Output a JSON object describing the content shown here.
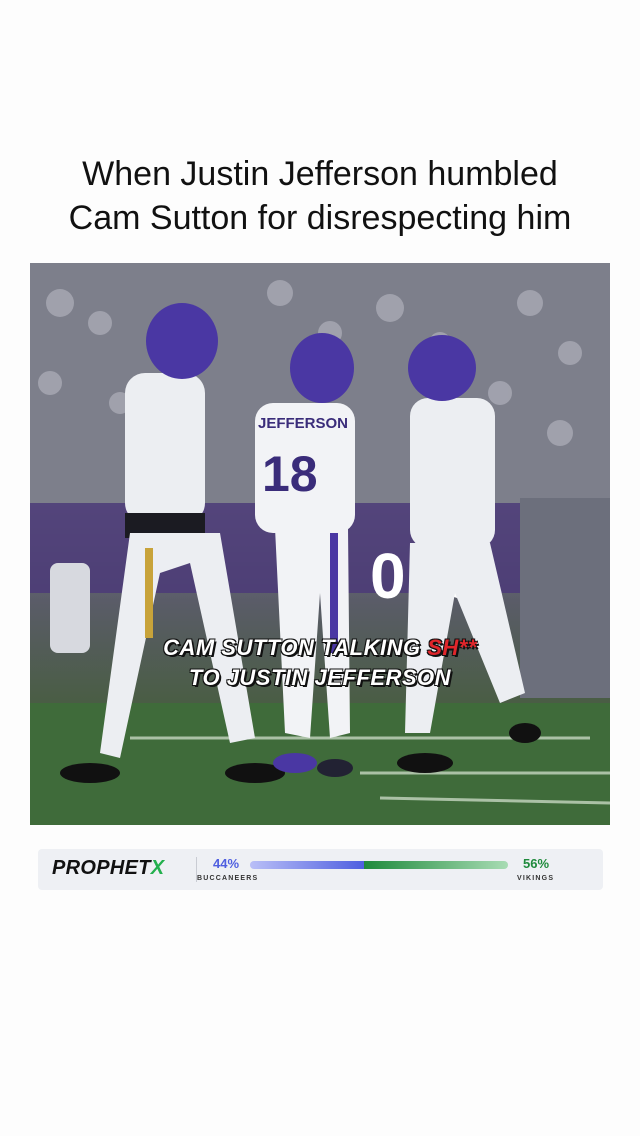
{
  "post": {
    "headline_line1": "When Justin Jefferson humbled",
    "headline_line2": "Cam Sutton for disrespecting him"
  },
  "video": {
    "jersey_name": "JEFFERSON",
    "jersey_number": "18",
    "caption_line1_white": "CAM SUTTON TALKING ",
    "caption_line1_red": "SH**",
    "caption_line2": "TO JUSTIN JEFFERSON"
  },
  "banner": {
    "logo_text": "PROPHET",
    "logo_accent": "X",
    "left_team": {
      "percent": "44%",
      "name": "BUCCANEERS",
      "share": 0.44,
      "color": "#4f5fe0"
    },
    "right_team": {
      "percent": "56%",
      "name": "VIKINGS",
      "share": 0.56,
      "color": "#1f8a3c"
    }
  }
}
